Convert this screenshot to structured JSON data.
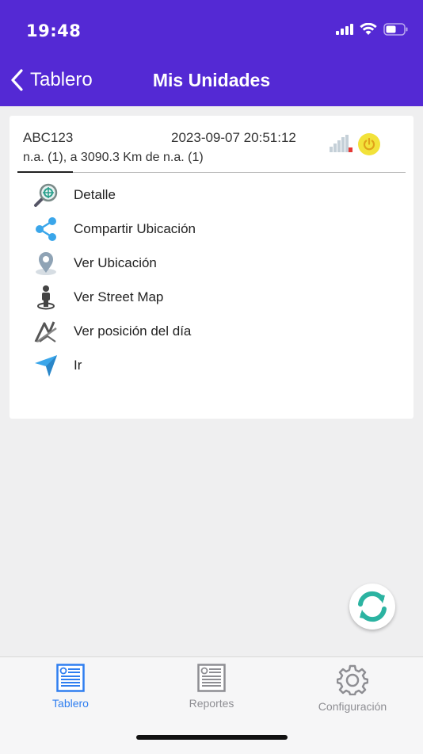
{
  "status_bar": {
    "time": "19:48"
  },
  "header": {
    "back_label": "Tablero",
    "title": "Mis Unidades"
  },
  "unit": {
    "name": "ABC123",
    "datetime": "2023-09-07 20:51:12",
    "location": "n.a. (1), a 3090.3 Km de n.a. (1)"
  },
  "menu": [
    {
      "label": "Detalle",
      "icon": "magnifier-target-icon"
    },
    {
      "label": "Compartir Ubicación",
      "icon": "share-icon"
    },
    {
      "label": "Ver Ubicación",
      "icon": "map-pin-icon"
    },
    {
      "label": "Ver Street Map",
      "icon": "street-person-icon"
    },
    {
      "label": "Ver posición del día",
      "icon": "route-icon"
    },
    {
      "label": "Ir",
      "icon": "navigate-arrow-icon"
    }
  ],
  "tabs": [
    {
      "label": "Tablero",
      "active": true
    },
    {
      "label": "Reportes",
      "active": false
    },
    {
      "label": "Configuración",
      "active": false
    }
  ],
  "colors": {
    "header": "#5429d4",
    "tab_active": "#2f7ef0",
    "tab_inactive": "#8e8e93",
    "share": "#3aa6ea",
    "refresh": "#2bb3a1"
  }
}
